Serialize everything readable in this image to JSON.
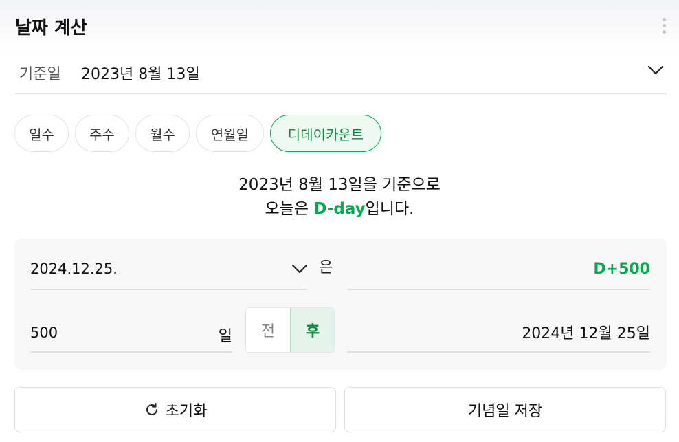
{
  "header": {
    "title": "날짜 계산",
    "more_icon": "more-vertical-icon"
  },
  "base_date": {
    "label": "기준일",
    "value": "2023년 8월 13일"
  },
  "tabs": [
    {
      "label": "일수",
      "active": false
    },
    {
      "label": "주수",
      "active": false
    },
    {
      "label": "월수",
      "active": false
    },
    {
      "label": "연월일",
      "active": false
    },
    {
      "label": "디데이카운트",
      "active": true
    }
  ],
  "message": {
    "line1": "2023년 8월 13일을 기준으로",
    "line2_prefix": "오늘은 ",
    "line2_highlight": "D-day",
    "line2_suffix": "입니다."
  },
  "calc": {
    "target_date": "2024.12.25.",
    "particle": "은",
    "dday_result": "D+500",
    "days_value": "500",
    "days_unit": "일",
    "direction_options": [
      "전",
      "후"
    ],
    "direction_selected": "후",
    "date_result": "2024년 12월 25일"
  },
  "buttons": {
    "reset_label": "초기화",
    "save_label": "기념일 저장"
  },
  "colors": {
    "accent": "#03a94d",
    "accent_bg": "#eef9f1",
    "card_bg": "#f8f8f8",
    "border": "#e3e4e6"
  }
}
